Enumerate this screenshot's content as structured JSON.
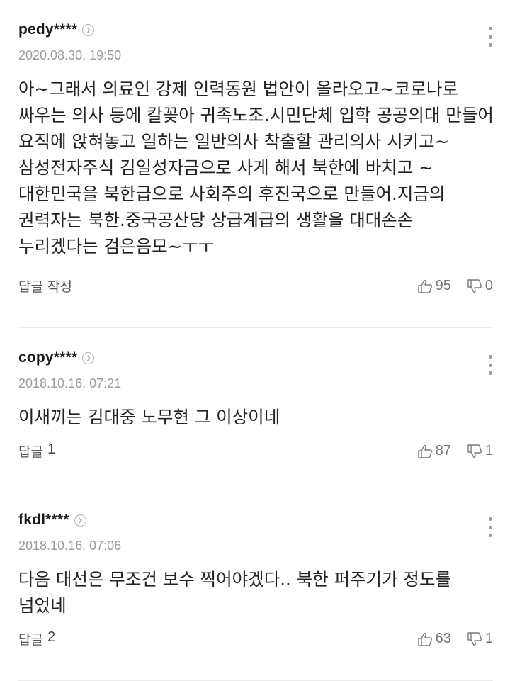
{
  "comments": [
    {
      "nickname": "pedy****",
      "date": "2020.08.30. 19:50",
      "text": "아~그래서 의료인 강제 인력동원 법안이 올라오고~코로나로 싸우는 의사 등에 칼꽂아 귀족노조.시민단체 입학 공공의대 만들어 요직에 앉혀놓고 일하는 일반의사 착출할 관리의사 시키고~삼성전자주식 김일성자금으로 사게 해서 북한에 바치고 ~대한민국을 북한급으로 사회주의 후진국으로 만들어.지금의 권력자는 북한.중국공산당 상급계급의 생활을 대대손손 누리겠다는 검은음모~ㅜㅜ",
      "reply_label": "답글 작성",
      "reply_count": "",
      "likes": "95",
      "dislikes": "0"
    },
    {
      "nickname": "copy****",
      "date": "2018.10.16. 07:21",
      "text": "이새끼는 김대중 노무현 그 이상이네",
      "reply_label": "답글",
      "reply_count": "1",
      "likes": "87",
      "dislikes": "1"
    },
    {
      "nickname": "fkdl****",
      "date": "2018.10.16. 07:06",
      "text": "다음 대선은 무조건 보수 찍어야겠다.. 북한 퍼주기가 정도를 넘었네",
      "reply_label": "답글",
      "reply_count": "2",
      "likes": "63",
      "dislikes": "1"
    }
  ],
  "icons": {
    "profile_link": "chevron-right-circle-icon",
    "more": "more-vertical-icon",
    "like": "thumbs-up-icon",
    "dislike": "thumbs-down-icon"
  }
}
